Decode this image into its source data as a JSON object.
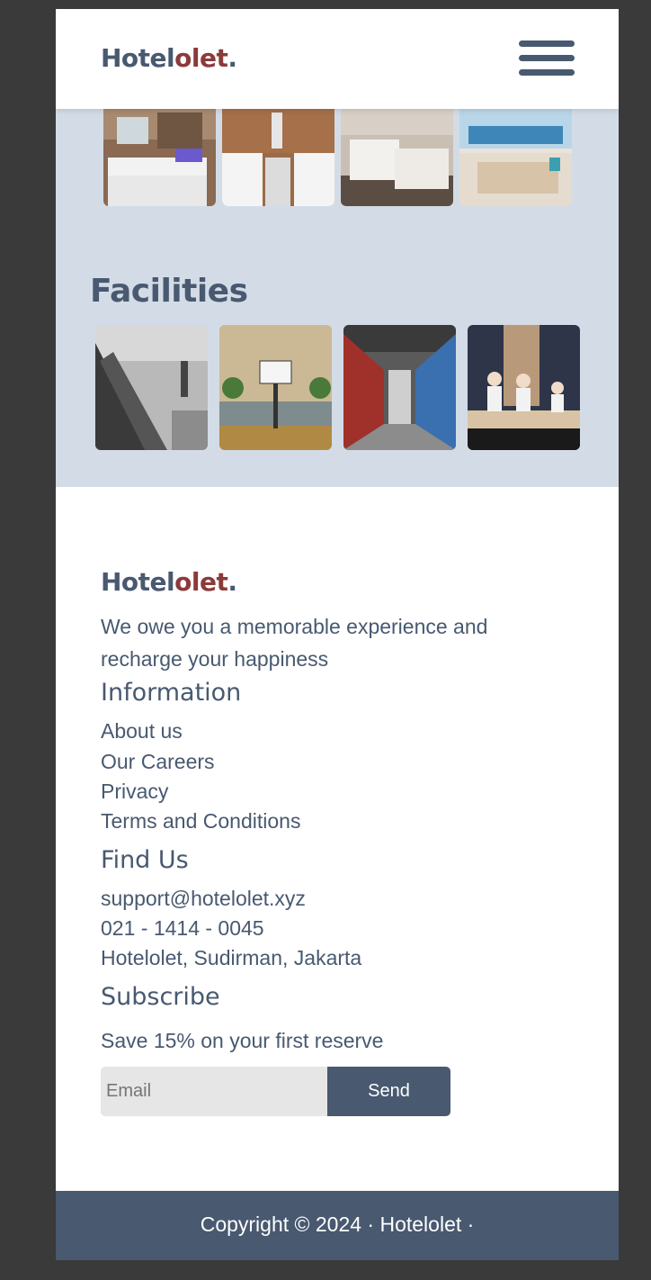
{
  "header": {
    "logo_main": "Hotel",
    "logo_accent": "olet",
    "logo_dot": ".",
    "menu_icon": "hamburger-menu-icon"
  },
  "rooms": {
    "images": [
      "twin-bedroom-photo",
      "twin-bedroom-wood-wall-photo",
      "twin-bedroom-dark-floor-photo",
      "seaview-bedroom-photo"
    ]
  },
  "facilities": {
    "title": "Facilities",
    "images": [
      "gym-dumbbells-photo",
      "basketball-court-photo",
      "supermarket-aisle-photo",
      "sushi-chefs-restaurant-photo"
    ]
  },
  "footer": {
    "logo_main": "Hotel",
    "logo_accent": "olet",
    "logo_dot": ".",
    "tagline": "We owe you a memorable experience and recharge your happiness",
    "information": {
      "title": "Information",
      "links": [
        "About us",
        "Our Careers",
        "Privacy",
        "Terms and Conditions"
      ]
    },
    "find_us": {
      "title": "Find Us",
      "email": "support@hotelolet.xyz",
      "phone": "021 - 1414 - 0045",
      "address": "Hotelolet, Sudirman, Jakarta"
    },
    "subscribe": {
      "title": "Subscribe",
      "text": "Save 15% on your first reserve",
      "email_placeholder": "Email",
      "send_label": "Send"
    }
  },
  "copyright": {
    "text": "Copyright © 2024 · Hotelolet ·"
  },
  "colors": {
    "primary": "#485970",
    "accent": "#8b3a3a",
    "section_bg": "#d3dce6"
  }
}
